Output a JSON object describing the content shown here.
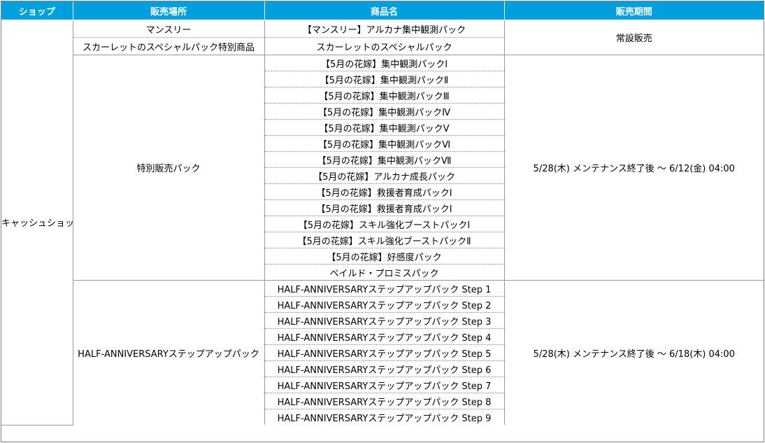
{
  "headers": [
    "ショップ",
    "販売場所",
    "商品名",
    "販売期間"
  ],
  "shop": "キャッシュショップ",
  "groups": [
    {
      "locations": [
        "マンスリー",
        "スカーレットのスペシャルパック特別商品"
      ],
      "products": [
        "【マンスリー】アルカナ集中観測パック",
        "スカーレットのスペシャルパック"
      ],
      "period": "常設販売"
    },
    {
      "location": "特別販売パック",
      "products": [
        "【5月の花嫁】集中観測パックⅠ",
        "【5月の花嫁】集中観測パックⅡ",
        "【5月の花嫁】集中観測パックⅢ",
        "【5月の花嫁】集中観測パックⅣ",
        "【5月の花嫁】集中観測パックⅤ",
        "【5月の花嫁】集中観測パックⅥ",
        "【5月の花嫁】集中観測パックⅦ",
        "【5月の花嫁】アルカナ成長パック",
        "【5月の花嫁】救援者育成パックⅠ",
        "【5月の花嫁】救援者育成パックⅠ",
        "【5月の花嫁】スキル強化ブーストパックⅠ",
        "【5月の花嫁】スキル強化ブーストパックⅡ",
        "【5月の花嫁】好感度パック",
        "ベイルド・プロミスパック"
      ],
      "period": "5/28(木) メンテナンス終了後 ～ 6/12(金) 04:00"
    },
    {
      "location": "HALF-ANNIVERSARYステップアップパック",
      "products": [
        "HALF-ANNIVERSARYステップアップパック Step 1",
        "HALF-ANNIVERSARYステップアップパック Step 2",
        "HALF-ANNIVERSARYステップアップパック Step 3",
        "HALF-ANNIVERSARYステップアップパック Step 4",
        "HALF-ANNIVERSARYステップアップパック Step 5",
        "HALF-ANNIVERSARYステップアップパック Step 6",
        "HALF-ANNIVERSARYステップアップパック Step 7",
        "HALF-ANNIVERSARYステップアップパック Step 8",
        "HALF-ANNIVERSARYステップアップパック Step 9"
      ],
      "period": "5/28(木) メンテナンス終了後 ～ 6/18(木) 04:00"
    }
  ],
  "colors": {
    "header_bg": "#00a0df",
    "header_text": "#ffffff",
    "grid": "#9a9a9a"
  }
}
